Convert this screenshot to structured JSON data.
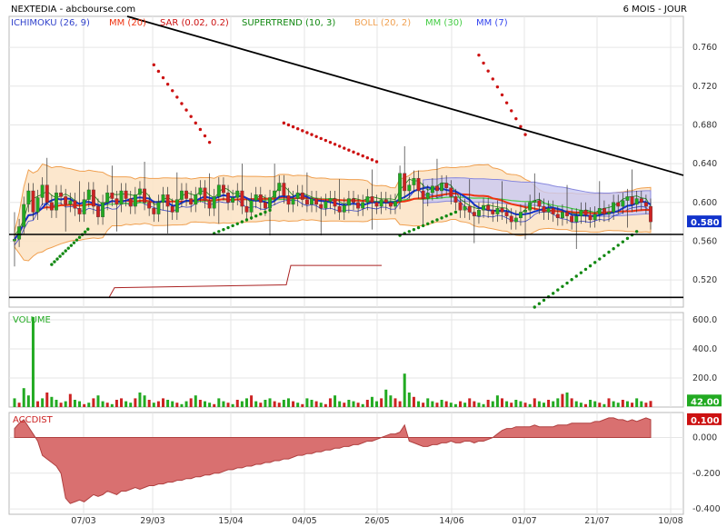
{
  "header": {
    "title": "NEXTEDIA - abcbourse.com",
    "period": "6 MOIS - JOUR"
  },
  "colors": {
    "up": "#22aa22",
    "down": "#cc2222",
    "ichimoku": "#3344cc",
    "mm20": "#ee3311",
    "sar": "#cc1111",
    "supertrend": "#118811",
    "boll": "#f0a050",
    "mm30": "#44cc44",
    "mm7": "#1133cc",
    "accdist": "#d97070"
  },
  "chart_data": [
    {
      "type": "candlestick",
      "panel": "price",
      "indicators": [
        {
          "name": "ICHIMOKU (26, 9)",
          "color": "#3344cc"
        },
        {
          "name": "MM (20)",
          "color": "#ee3311"
        },
        {
          "name": "SAR (0.02, 0.2)",
          "color": "#cc1111"
        },
        {
          "name": "SUPERTREND (10, 3)",
          "color": "#118811"
        },
        {
          "name": "BOLL (20, 2)",
          "color": "#f0a050"
        },
        {
          "name": "MM (30)",
          "color": "#44cc44"
        },
        {
          "name": "MM (7)",
          "color": "#3344ee"
        }
      ],
      "yticks": [
        "0.760",
        "0.720",
        "0.680",
        "0.640",
        "0.600",
        "0.560",
        "0.520"
      ],
      "ylim": [
        0.492,
        0.792
      ],
      "xticks": [
        "07/03",
        "29/03",
        "15/04",
        "04/05",
        "26/05",
        "14/06",
        "01/07",
        "21/07",
        "10/08"
      ],
      "last_value": "0.580",
      "horizontal_lines": [
        0.567,
        0.502
      ],
      "trendline": [
        [
          0.792,
          0
        ],
        [
          0.628,
          1
        ]
      ],
      "close": [
        0.562,
        0.575,
        0.598,
        0.612,
        0.59,
        0.605,
        0.618,
        0.6,
        0.592,
        0.61,
        0.606,
        0.598,
        0.602,
        0.594,
        0.588,
        0.603,
        0.613,
        0.596,
        0.585,
        0.6,
        0.61,
        0.604,
        0.598,
        0.612,
        0.604,
        0.596,
        0.608,
        0.614,
        0.6,
        0.594,
        0.588,
        0.6,
        0.608,
        0.596,
        0.59,
        0.603,
        0.612,
        0.604,
        0.598,
        0.608,
        0.615,
        0.602,
        0.594,
        0.606,
        0.618,
        0.61,
        0.6,
        0.605,
        0.612,
        0.596,
        0.59,
        0.602,
        0.608,
        0.6,
        0.594,
        0.605,
        0.612,
        0.62,
        0.607,
        0.598,
        0.604,
        0.61,
        0.603,
        0.598,
        0.604,
        0.598,
        0.594,
        0.601,
        0.604,
        0.596,
        0.59,
        0.597,
        0.604,
        0.6,
        0.594,
        0.6,
        0.606,
        0.6,
        0.596,
        0.603,
        0.6,
        0.596,
        0.601,
        0.63,
        0.612,
        0.618,
        0.625,
        0.612,
        0.604,
        0.61,
        0.617,
        0.612,
        0.62,
        0.615,
        0.606,
        0.6,
        0.592,
        0.596,
        0.59,
        0.586,
        0.592,
        0.597,
        0.592,
        0.588,
        0.594,
        0.59,
        0.586,
        0.58,
        0.584,
        0.59,
        0.592,
        0.6,
        0.602,
        0.596,
        0.59,
        0.594,
        0.588,
        0.584,
        0.59,
        0.586,
        0.58,
        0.586,
        0.592,
        0.587,
        0.582,
        0.588,
        0.594,
        0.588,
        0.59,
        0.6,
        0.596,
        0.602,
        0.606,
        0.598,
        0.604,
        0.6,
        0.596,
        0.58
      ]
    },
    {
      "type": "bar",
      "panel": "volume",
      "name": "VOLUME",
      "yticks": [
        "600.0",
        "400.0",
        "200.0"
      ],
      "ylim": [
        0,
        650
      ],
      "last_value": "42.00",
      "values": [
        60,
        30,
        130,
        80,
        620,
        40,
        60,
        100,
        70,
        50,
        30,
        40,
        90,
        50,
        40,
        20,
        30,
        60,
        80,
        40,
        30,
        20,
        50,
        60,
        40,
        30,
        60,
        100,
        80,
        50,
        30,
        40,
        60,
        50,
        40,
        30,
        20,
        40,
        60,
        80,
        50,
        40,
        30,
        20,
        60,
        40,
        30,
        20,
        50,
        40,
        60,
        80,
        40,
        30,
        50,
        60,
        40,
        30,
        50,
        60,
        40,
        30,
        20,
        60,
        50,
        40,
        30,
        20,
        60,
        80,
        40,
        30,
        50,
        40,
        30,
        20,
        50,
        70,
        40,
        60,
        120,
        80,
        60,
        40,
        230,
        100,
        70,
        40,
        30,
        60,
        40,
        30,
        50,
        40,
        30,
        20,
        40,
        30,
        60,
        40,
        30,
        20,
        50,
        40,
        80,
        60,
        40,
        30,
        50,
        40,
        30,
        20,
        60,
        40,
        30,
        50,
        40,
        60,
        90,
        100,
        60,
        40,
        30,
        20,
        50,
        40,
        30,
        20,
        60,
        40,
        30,
        50,
        40,
        30,
        60,
        40,
        30,
        42
      ],
      "up": [
        1,
        0,
        1,
        1,
        1,
        0,
        1,
        0,
        1,
        1,
        0,
        1,
        0,
        1,
        1,
        0,
        1,
        0,
        1,
        1,
        0,
        1,
        0,
        0,
        1,
        1,
        0,
        1,
        1,
        0,
        1,
        0,
        0,
        1,
        1,
        0,
        1,
        1,
        0,
        1,
        0,
        1,
        1,
        0,
        1,
        1,
        0,
        1,
        0,
        1,
        1,
        0,
        1,
        0,
        1,
        1,
        0,
        0,
        1,
        1,
        0,
        1,
        0,
        1,
        1,
        0,
        1,
        0,
        0,
        1,
        1,
        0,
        1,
        1,
        0,
        1,
        0,
        1,
        1,
        0,
        1,
        1,
        0,
        0,
        1,
        1,
        0,
        1,
        0,
        1,
        1,
        0,
        1,
        0,
        1,
        1,
        0,
        1,
        0,
        0,
        1,
        1,
        0,
        1,
        1,
        0,
        1,
        0,
        1,
        1,
        0,
        1,
        0,
        1,
        1,
        0,
        1,
        1,
        0,
        1,
        0,
        1,
        1,
        0,
        1,
        1,
        0,
        1,
        0,
        1,
        1,
        0,
        1,
        0,
        1,
        1
      ]
    },
    {
      "type": "area",
      "panel": "accdist",
      "name": "ACCDIST",
      "yticks": [
        "0.000",
        "-0.200",
        "-0.400"
      ],
      "ylim": [
        -0.43,
        0.14
      ],
      "last_value": "0.100",
      "values": [
        0.05,
        0.08,
        0.1,
        0.06,
        0.02,
        -0.02,
        -0.1,
        -0.12,
        -0.14,
        -0.16,
        -0.2,
        -0.34,
        -0.37,
        -0.36,
        -0.35,
        -0.36,
        -0.34,
        -0.32,
        -0.33,
        -0.32,
        -0.3,
        -0.31,
        -0.32,
        -0.3,
        -0.3,
        -0.29,
        -0.28,
        -0.29,
        -0.28,
        -0.27,
        -0.27,
        -0.26,
        -0.26,
        -0.25,
        -0.25,
        -0.24,
        -0.24,
        -0.23,
        -0.23,
        -0.22,
        -0.22,
        -0.21,
        -0.21,
        -0.2,
        -0.2,
        -0.19,
        -0.18,
        -0.18,
        -0.17,
        -0.17,
        -0.16,
        -0.16,
        -0.15,
        -0.15,
        -0.14,
        -0.14,
        -0.13,
        -0.13,
        -0.12,
        -0.12,
        -0.11,
        -0.1,
        -0.1,
        -0.09,
        -0.09,
        -0.08,
        -0.08,
        -0.07,
        -0.07,
        -0.06,
        -0.06,
        -0.05,
        -0.05,
        -0.04,
        -0.04,
        -0.03,
        -0.02,
        -0.02,
        -0.01,
        0.0,
        0.01,
        0.02,
        0.02,
        0.03,
        0.07,
        -0.02,
        -0.03,
        -0.04,
        -0.05,
        -0.05,
        -0.04,
        -0.04,
        -0.03,
        -0.03,
        -0.02,
        -0.03,
        -0.03,
        -0.02,
        -0.02,
        -0.03,
        -0.02,
        -0.02,
        -0.01,
        0.0,
        0.02,
        0.04,
        0.05,
        0.05,
        0.06,
        0.06,
        0.06,
        0.06,
        0.07,
        0.06,
        0.06,
        0.06,
        0.06,
        0.07,
        0.07,
        0.07,
        0.08,
        0.08,
        0.08,
        0.08,
        0.08,
        0.09,
        0.09,
        0.1,
        0.11,
        0.11,
        0.1,
        0.1,
        0.09,
        0.1,
        0.09,
        0.1,
        0.11,
        0.1
      ]
    }
  ]
}
